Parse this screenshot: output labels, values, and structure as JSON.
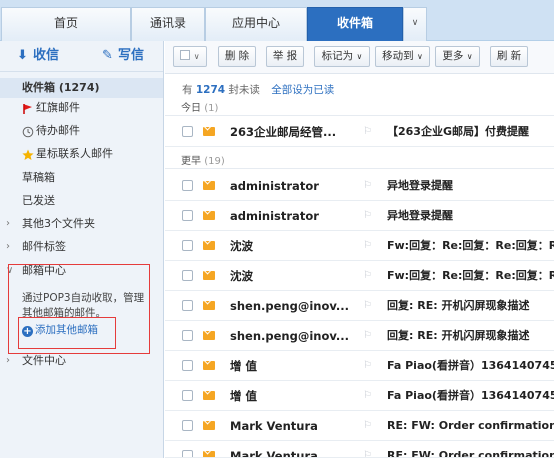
{
  "tabs": [
    "首页",
    "通讯录",
    "应用中心",
    "收件箱"
  ],
  "compose": {
    "receive": "收信",
    "write": "写信"
  },
  "sidebar": {
    "inbox": "收件箱 (1274)",
    "redflag": "红旗邮件",
    "pending": "待办邮件",
    "starred": "星标联系人邮件",
    "drafts": "草稿箱",
    "sent": "已发送",
    "other_folders": "其他3个文件夹",
    "mail_tags": "邮件标签",
    "mailbox_center": "邮箱中心",
    "pop3_text": "通过POP3自动收取，管理其他邮箱的邮件。",
    "add_mailbox": "添加其他邮箱",
    "file_center": "文件中心"
  },
  "toolbar": {
    "delete": "删 除",
    "report": "举 报",
    "mark_as": "标记为",
    "move_to": "移动到",
    "more": "更多",
    "refresh": "刷 新"
  },
  "summary": {
    "prefix": "有",
    "count": "1274",
    "suffix": "封未读",
    "mark_all": "全部设为已读"
  },
  "groups": {
    "today": {
      "label": "今日",
      "count": "(1)"
    },
    "earlier": {
      "label": "更早",
      "count": "(19)"
    }
  },
  "emails": [
    {
      "sender": "263企业邮局经管...",
      "subject": "【263企业G邮局】付费提醒"
    },
    {
      "sender": "administrator",
      "subject": "异地登录提醒"
    },
    {
      "sender": "administrator",
      "subject": "异地登录提醒"
    },
    {
      "sender": "沈波",
      "subject": "Fw:回复：Re:回复：Re:回复：Re"
    },
    {
      "sender": "沈波",
      "subject": "Fw:回复：Re:回复：Re:回复：Re"
    },
    {
      "sender": "shen.peng@inov...",
      "subject": "回复: RE: 开机闪屏现象描述"
    },
    {
      "sender": "shen.peng@inov...",
      "subject": "回复: RE: 开机闪屏现象描述"
    },
    {
      "sender": "增 值",
      "subject": "Fa Piao(看拼音）13641407459"
    },
    {
      "sender": "增 值",
      "subject": "Fa Piao(看拼音）13641407459"
    },
    {
      "sender": "Mark Ventura",
      "subject": "RE: FW: Order confirmation 2"
    },
    {
      "sender": "Mark Ventura",
      "subject": "RE: FW: Order confirmation 2"
    }
  ]
}
